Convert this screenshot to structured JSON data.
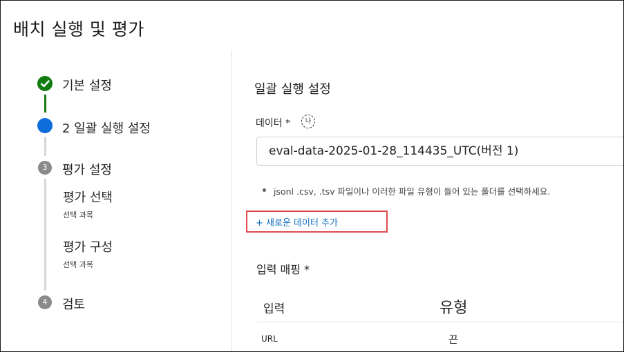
{
  "page": {
    "title": "배치 실행 및 평가"
  },
  "stepper": {
    "steps": [
      {
        "label": "기본 설정",
        "status": "done"
      },
      {
        "label": "2 일괄 실행 설정",
        "status": "current"
      },
      {
        "number": "3",
        "label": "평가 설정",
        "status": "upcoming",
        "substeps": [
          {
            "label": "평가 선택",
            "hint": "선택 과목"
          },
          {
            "label": "평가 구성",
            "hint": "선택 과목"
          }
        ]
      },
      {
        "number": "4",
        "label": "검토",
        "status": "upcoming"
      }
    ]
  },
  "main": {
    "section_title": "일괄 실행 설정",
    "data_field": {
      "label": "데이터 *",
      "info_icon_text": "나",
      "value": "eval-data-2025-01-28_114435_UTC(버전 1)",
      "hint": "jsonl .csv, .tsv 파일이나 이러한 파일 유형이 들어 있는 폴더를 선택하세요."
    },
    "add_data_link": "+ 새로운 데이터 추가",
    "input_mapping": {
      "title": "입력 매핑 *",
      "columns": [
        "입력",
        "유형"
      ],
      "rows": [
        {
          "input": "URL",
          "type": "끈"
        }
      ]
    }
  },
  "colors": {
    "done": "#107c10",
    "current": "#0f6cdb",
    "upcoming": "#8a8a8a",
    "link": "#0f6cbd",
    "highlight": "#e0484f"
  }
}
